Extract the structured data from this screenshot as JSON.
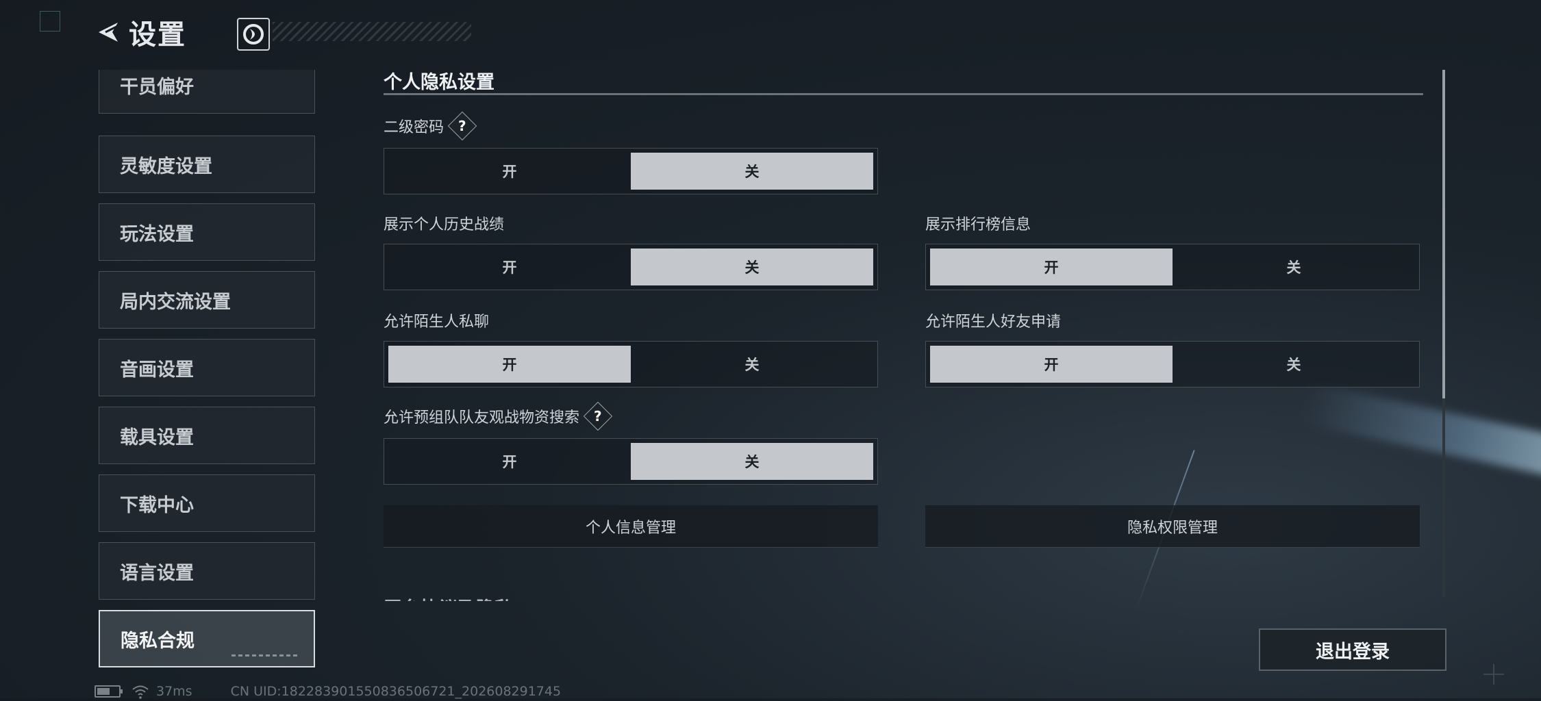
{
  "header": {
    "title": "设置"
  },
  "sidebar": {
    "items": [
      {
        "label": "干员偏好",
        "active": false
      },
      {
        "label": "灵敏度设置",
        "active": false
      },
      {
        "label": "玩法设置",
        "active": false
      },
      {
        "label": "局内交流设置",
        "active": false
      },
      {
        "label": "音画设置",
        "active": false
      },
      {
        "label": "载具设置",
        "active": false
      },
      {
        "label": "下载中心",
        "active": false
      },
      {
        "label": "语言设置",
        "active": false
      },
      {
        "label": "隐私合规",
        "active": true
      }
    ]
  },
  "privacy": {
    "section_title": "个人隐私设置",
    "help_glyph": "?",
    "on_label": "开",
    "off_label": "关",
    "settings": [
      {
        "label": "二级密码",
        "has_help": true,
        "value": "关"
      },
      {
        "label": "展示个人历史战绩",
        "has_help": false,
        "value": "关"
      },
      {
        "label": "展示排行榜信息",
        "has_help": false,
        "value": "开"
      },
      {
        "label": "允许陌生人私聊",
        "has_help": false,
        "value": "开"
      },
      {
        "label": "允许陌生人好友申请",
        "has_help": false,
        "value": "开"
      },
      {
        "label": "允许预组队队友观战物资搜索",
        "has_help": true,
        "value": "关"
      }
    ],
    "buttons": {
      "info_manage": "个人信息管理",
      "permission_manage": "隐私权限管理"
    },
    "next_section_title": "平台协议及隐私"
  },
  "logout_label": "退出登录",
  "status": {
    "ping": "37ms",
    "uid": "CN UID:18228390155083650672​1_202608291745"
  },
  "colors": {
    "selected_bg": "#c4c8cc",
    "panel_border": "#464d54",
    "text": "#d9dde2"
  }
}
